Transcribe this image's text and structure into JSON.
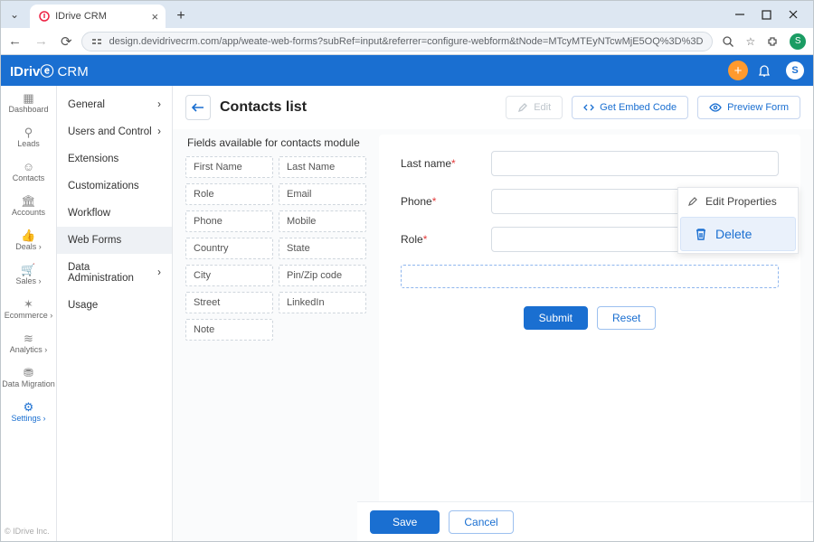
{
  "browser": {
    "tab_title": "IDrive CRM",
    "url": "design.devidrivecrm.com/app/weate-web-forms?subRef=input&referrer=configure-webform&tNode=MTcyMTEyNTcwMjE5OQ%3D%3D"
  },
  "app_header": {
    "brand_prefix": "IDriv",
    "brand_suffix": " CRM",
    "avatar_letter": "S"
  },
  "primary_nav": {
    "items": [
      {
        "label": "Dashboard"
      },
      {
        "label": "Leads"
      },
      {
        "label": "Contacts"
      },
      {
        "label": "Accounts"
      },
      {
        "label": "Deals ›"
      },
      {
        "label": "Sales ›"
      },
      {
        "label": "Ecommerce ›"
      },
      {
        "label": "Analytics ›"
      },
      {
        "label": "Data Migration"
      },
      {
        "label": "Settings ›",
        "active": true
      }
    ],
    "copyright": "© IDrive Inc."
  },
  "secondary_nav": {
    "items": [
      {
        "label": "General",
        "chev": true
      },
      {
        "label": "Users and Control",
        "chev": true
      },
      {
        "label": "Extensions"
      },
      {
        "label": "Customizations"
      },
      {
        "label": "Workflow"
      },
      {
        "label": "Web Forms",
        "active": true
      },
      {
        "label": "Data Administration",
        "chev": true
      },
      {
        "label": "Usage"
      }
    ]
  },
  "page": {
    "title": "Contacts list",
    "actions": {
      "edit": "Edit",
      "embed": "Get Embed Code",
      "preview": "Preview Form"
    }
  },
  "fields_pane": {
    "title": "Fields available for contacts module",
    "fields": [
      "First Name",
      "Last Name",
      "Role",
      "Email",
      "Phone",
      "Mobile",
      "Country",
      "State",
      "City",
      "Pin/Zip code",
      "Street",
      "LinkedIn",
      "Note"
    ]
  },
  "form": {
    "rows": [
      {
        "label": "Last name",
        "required": true
      },
      {
        "label": "Phone",
        "required": true,
        "kebab": true
      },
      {
        "label": "Role",
        "required": true
      }
    ],
    "submit": "Submit",
    "reset": "Reset"
  },
  "popover": {
    "edit": "Edit Properties",
    "delete": "Delete"
  },
  "footer": {
    "save": "Save",
    "cancel": "Cancel"
  }
}
